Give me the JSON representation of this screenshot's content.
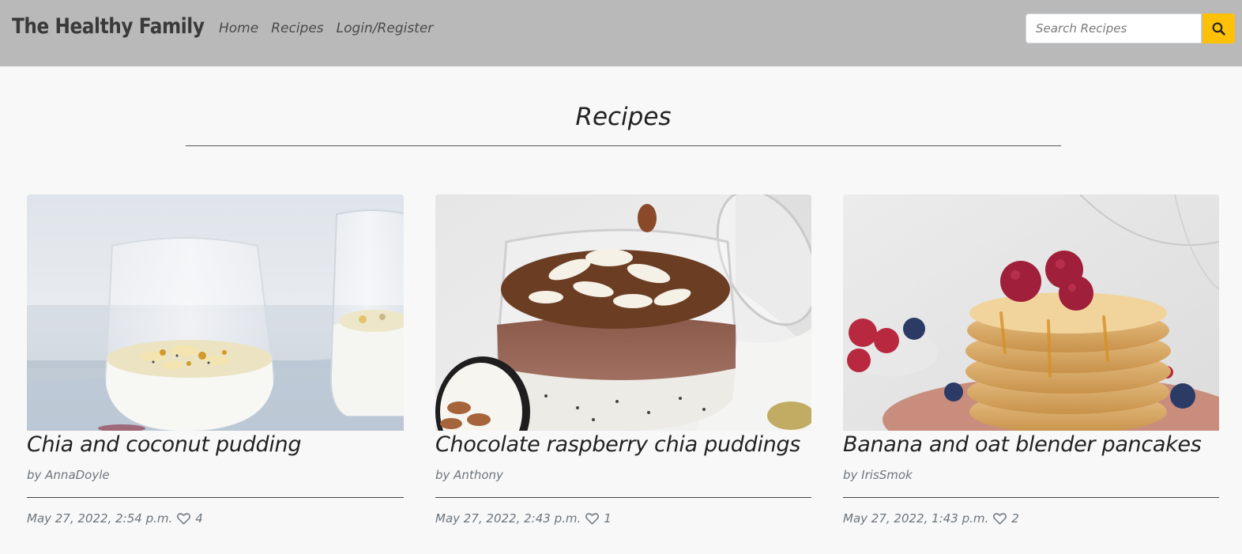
{
  "navbar": {
    "brand": "The Healthy Family",
    "links": [
      "Home",
      "Recipes",
      "Login/Register"
    ],
    "search_placeholder": "Search Recipes",
    "search_icon": "search-icon",
    "accent_color": "#ffc107",
    "bg_color": "#b9b9b9"
  },
  "main": {
    "title": "Recipes",
    "recipes": [
      {
        "title": "Chia and coconut pudding",
        "author": "by AnnaDoyle",
        "date": "May 27, 2022, 2:54 p.m.",
        "likes": "4",
        "image": "chia-coconut-pudding-photo"
      },
      {
        "title": "Chocolate raspberry chia puddings",
        "author": "by Anthony",
        "date": "May 27, 2022, 2:43 p.m.",
        "likes": "1",
        "image": "chocolate-chia-pudding-photo"
      },
      {
        "title": "Banana and oat blender pancakes",
        "author": "by IrisSmok",
        "date": "May 27, 2022, 1:43 p.m.",
        "likes": "2",
        "image": "pancake-stack-photo"
      }
    ]
  }
}
